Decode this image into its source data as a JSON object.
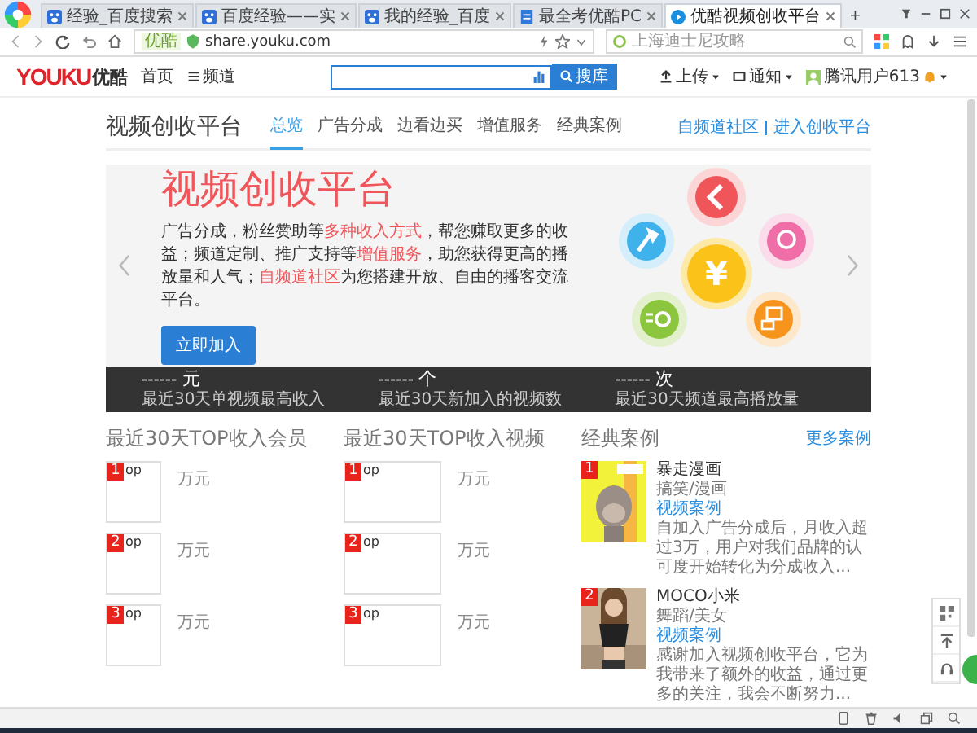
{
  "browser": {
    "tabs": [
      {
        "title": "经验_百度搜索",
        "kind": "paw",
        "selected": false
      },
      {
        "title": "百度经验——实",
        "kind": "paw",
        "selected": false
      },
      {
        "title": "我的经验_百度",
        "kind": "paw",
        "selected": false
      },
      {
        "title": "最全考优酷PC",
        "kind": "document",
        "selected": false
      },
      {
        "title": "优酷视频创收平台",
        "kind": "play",
        "selected": true
      }
    ],
    "new_tab": "+",
    "site_badge": "优酷",
    "url": "share.youku.com",
    "search_placeholder": "上海迪士尼攻略"
  },
  "header": {
    "logo": "YOUKU",
    "logo_cn": "优酷",
    "home": "首页",
    "channels": "频道",
    "search_button": "搜库",
    "upload": "上传",
    "notify": "通知",
    "user": "腾讯用户613"
  },
  "subnav": {
    "title": "视频创收平台",
    "tabs": [
      {
        "label": "总览",
        "selected": true
      },
      {
        "label": "广告分成",
        "selected": false
      },
      {
        "label": "边看边买",
        "selected": false
      },
      {
        "label": "增值服务",
        "selected": false
      },
      {
        "label": "经典案例",
        "selected": false
      }
    ],
    "links": [
      "自频道社区",
      "进入创收平台"
    ]
  },
  "banner": {
    "title": "视频创收平台",
    "paragraph": [
      {
        "text": "广告分成，粉丝赞助等",
        "highlight": false
      },
      {
        "text": "多种收入方式",
        "highlight": true
      },
      {
        "text": "，帮您赚取更多的收益；频道定制、推广支持等",
        "highlight": false
      },
      {
        "text": "增值服务",
        "highlight": true
      },
      {
        "text": "，助您获得更高的播放量和人气；",
        "highlight": false
      },
      {
        "text": "自频道社区",
        "highlight": true
      },
      {
        "text": "为您搭建开放、自由的播客交流平台。",
        "highlight": false
      }
    ],
    "button": "立即加入",
    "center_symbol": "¥"
  },
  "stats": [
    {
      "value": "------",
      "unit": "元",
      "label": "最近30天单视频最高收入"
    },
    {
      "value": "------",
      "unit": "个",
      "label": "最近30天新加入的视频数"
    },
    {
      "value": "------",
      "unit": "次",
      "label": "最近30天频道最高播放量"
    }
  ],
  "top_members": {
    "title": "最近30天TOP收入会员",
    "items": [
      {
        "rank": "1",
        "label": "op",
        "amount": "万元"
      },
      {
        "rank": "2",
        "label": "op",
        "amount": "万元"
      },
      {
        "rank": "3",
        "label": "op",
        "amount": "万元"
      }
    ]
  },
  "top_videos": {
    "title": "最近30天TOP收入视频",
    "items": [
      {
        "rank": "1",
        "label": "op",
        "amount": "万元"
      },
      {
        "rank": "2",
        "label": "op",
        "amount": "万元"
      },
      {
        "rank": "3",
        "label": "op",
        "amount": "万元"
      }
    ]
  },
  "cases": {
    "title": "经典案例",
    "more": "更多案例",
    "items": [
      {
        "rank": "1",
        "kind": "cartoon",
        "name": "暴走漫画",
        "tags": "搞笑/漫画",
        "link": "视频案例",
        "description": "自加入广告分成后，月收入超过3万，用户对我们品牌的认可度开始转化为分成收入..."
      },
      {
        "rank": "2",
        "kind": "person",
        "name": "MOCO小米",
        "tags": "舞蹈/美女",
        "link": "视频案例",
        "description": "感谢加入视频创收平台，它为我带来了额外的收益，通过更多的关注，我会不断努力..."
      }
    ]
  }
}
